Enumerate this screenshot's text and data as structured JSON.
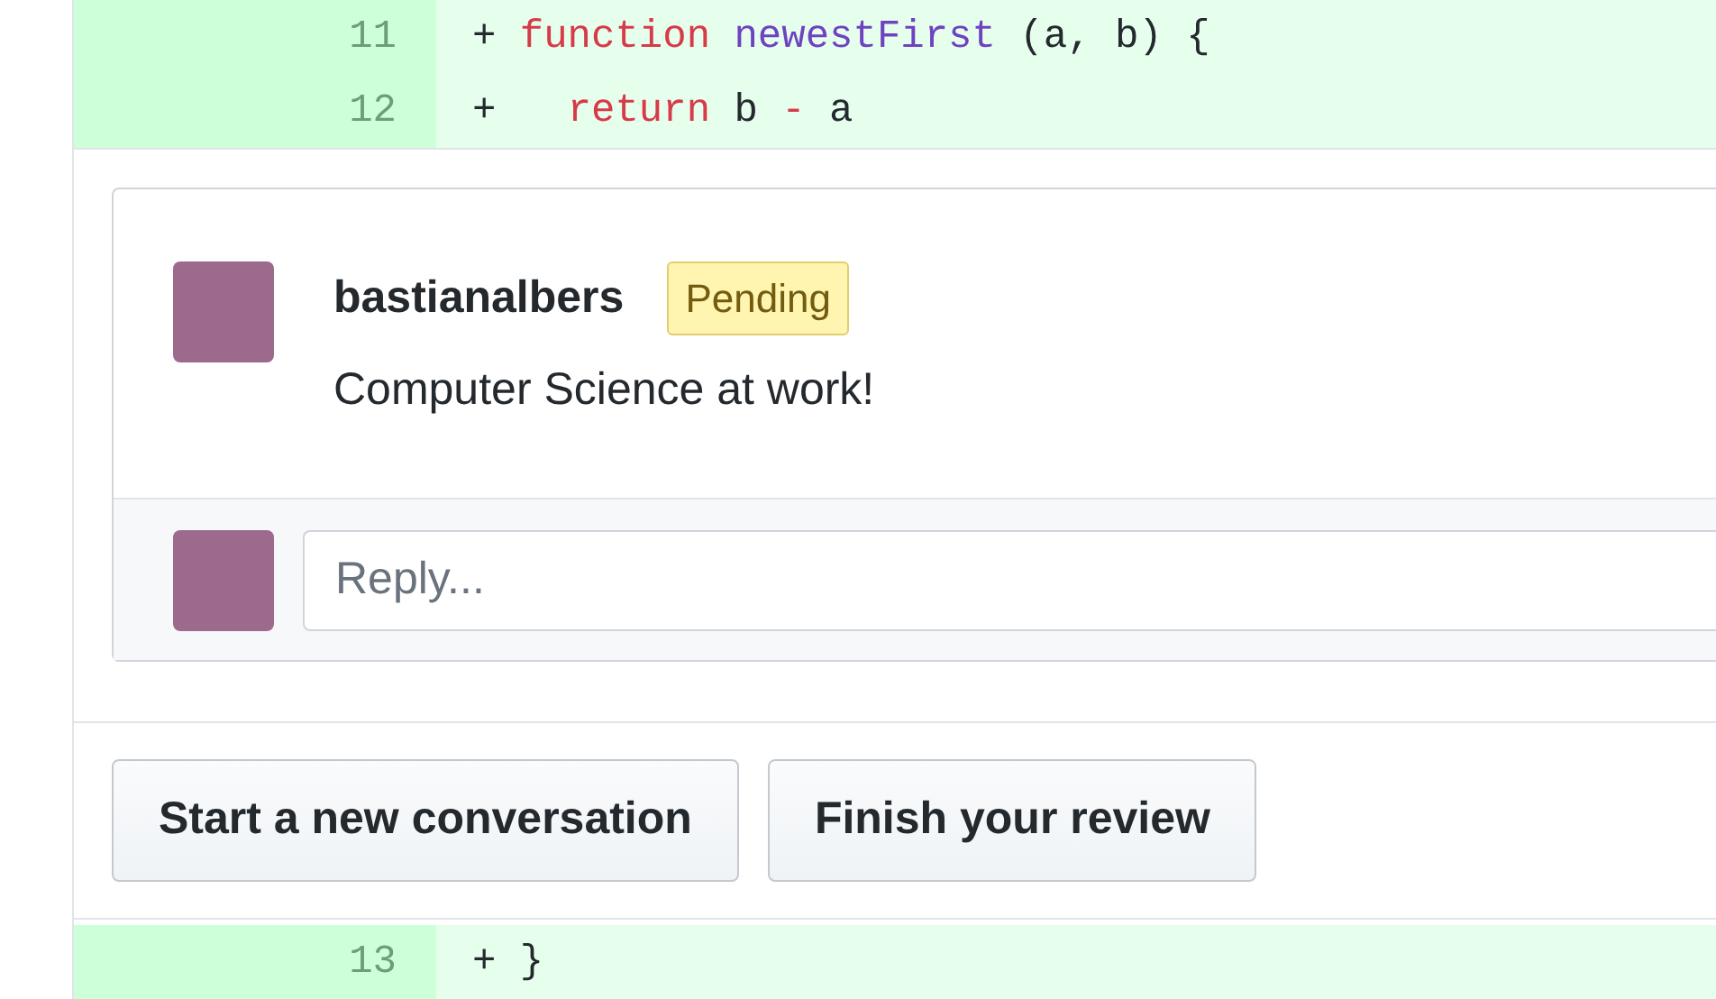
{
  "diff_top": [
    {
      "line_number": "11",
      "tokens": [
        {
          "text": "+ ",
          "kind": "plain"
        },
        {
          "text": "function",
          "kind": "keyword"
        },
        {
          "text": " newestFirst",
          "kind": "entity"
        },
        {
          "text": " (a, b) {",
          "kind": "plain"
        }
      ]
    },
    {
      "line_number": "12",
      "tokens": [
        {
          "text": "+   ",
          "kind": "plain"
        },
        {
          "text": "return",
          "kind": "keyword"
        },
        {
          "text": " b ",
          "kind": "plain"
        },
        {
          "text": "-",
          "kind": "keyword"
        },
        {
          "text": " a",
          "kind": "plain"
        }
      ]
    }
  ],
  "comment": {
    "author": "bastianalbers",
    "badge": "Pending",
    "body": "Computer Science at work!"
  },
  "reply": {
    "placeholder": "Reply..."
  },
  "buttons": [
    "Start a new conversation",
    "Finish your review"
  ],
  "diff_bottom": [
    {
      "line_number": "13",
      "tokens": [
        {
          "text": "+ }",
          "kind": "plain"
        }
      ]
    }
  ]
}
